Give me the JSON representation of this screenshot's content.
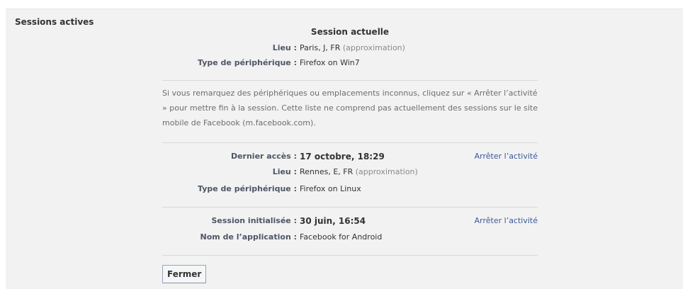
{
  "section_title": "Sessions actives",
  "current_session": {
    "title": "Session actuelle",
    "rows": [
      {
        "label": "Lieu :",
        "value": "Paris, J, FR",
        "note": "(approximation)"
      },
      {
        "label": "Type de périphérique :",
        "value": "Firefox on Win7"
      }
    ]
  },
  "info_text": "Si vous remarquez des périphériques ou emplacements inconnus, cliquez sur « Arrêter l’activité » pour mettre fin à la session. Cette liste ne comprend pas actuellement des sessions sur le site mobile de Facebook (m.facebook.com).",
  "sessions": [
    {
      "rows": [
        {
          "label": "Dernier accès :",
          "value": "17 octobre, 18:29"
        },
        {
          "label": "Lieu :",
          "value": "Rennes, E, FR",
          "note": "(approximation)"
        },
        {
          "label": "Type de périphérique :",
          "value": "Firefox on Linux"
        }
      ],
      "action": "Arrêter l’activité"
    },
    {
      "rows": [
        {
          "label": "Session initialisée :",
          "value": "30 juin, 16:54"
        },
        {
          "label": "Nom de l’application :",
          "value": "Facebook for Android"
        }
      ],
      "action": "Arrêter l’activité"
    }
  ],
  "close_button": "Fermer",
  "colors": {
    "link": "#3b5998",
    "label": "#4e5665",
    "panel_bg": "#f2f2f2",
    "divider": "#d8d8d8"
  }
}
